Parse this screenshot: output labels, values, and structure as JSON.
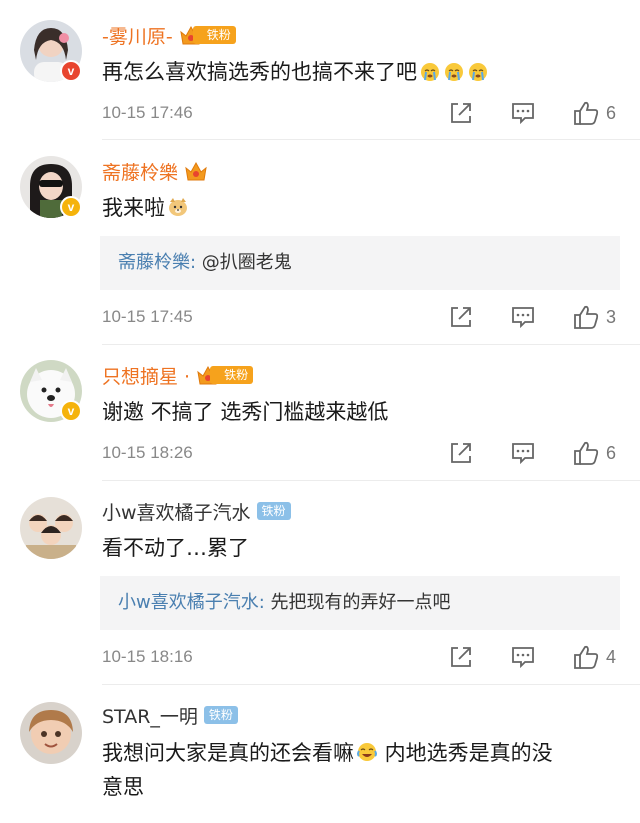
{
  "comments": [
    {
      "username": "-雾川原-",
      "fan_badge": "铁粉",
      "text": "再怎么喜欢搞选秀的也搞不来了吧",
      "emoji": "crying-emoji",
      "time": "10-15 17:46",
      "likes": "6"
    },
    {
      "username": "斋藤柃樂",
      "text": "我来啦",
      "emoji": "doge-emoji",
      "quote_name": "斋藤柃樂:",
      "quote_text": " @扒圈老鬼",
      "time": "10-15 17:45",
      "likes": "3"
    },
    {
      "username": "只想摘星 ·",
      "fan_badge": "铁粉",
      "text": "谢邀 不搞了 选秀门槛越来越低",
      "time": "10-15 18:26",
      "likes": "6"
    },
    {
      "username": "小w喜欢橘子汽水",
      "fan_badge": "铁粉",
      "text": "看不动了…累了",
      "quote_name": "小w喜欢橘子汽水:",
      "quote_text": " 先把现有的弄好一点吧",
      "time": "10-15 18:16",
      "likes": "4"
    },
    {
      "username": "STAR_一明",
      "fan_badge": "铁粉",
      "text_line1": "我想问大家是真的还会看嘛",
      "text_line1_after": " 内地选秀是真的没",
      "text_line2": "意思",
      "emoji": "laugh-cry-emoji"
    }
  ],
  "colors": {
    "username_orange": "#ee7322",
    "quote_name_blue": "#4a7fb0",
    "fan_badge_orange": "#f6a21c",
    "fan_badge_blue": "#8cc0e8",
    "verified_red": "#e8452f",
    "verified_yellow": "#f5b30b"
  }
}
